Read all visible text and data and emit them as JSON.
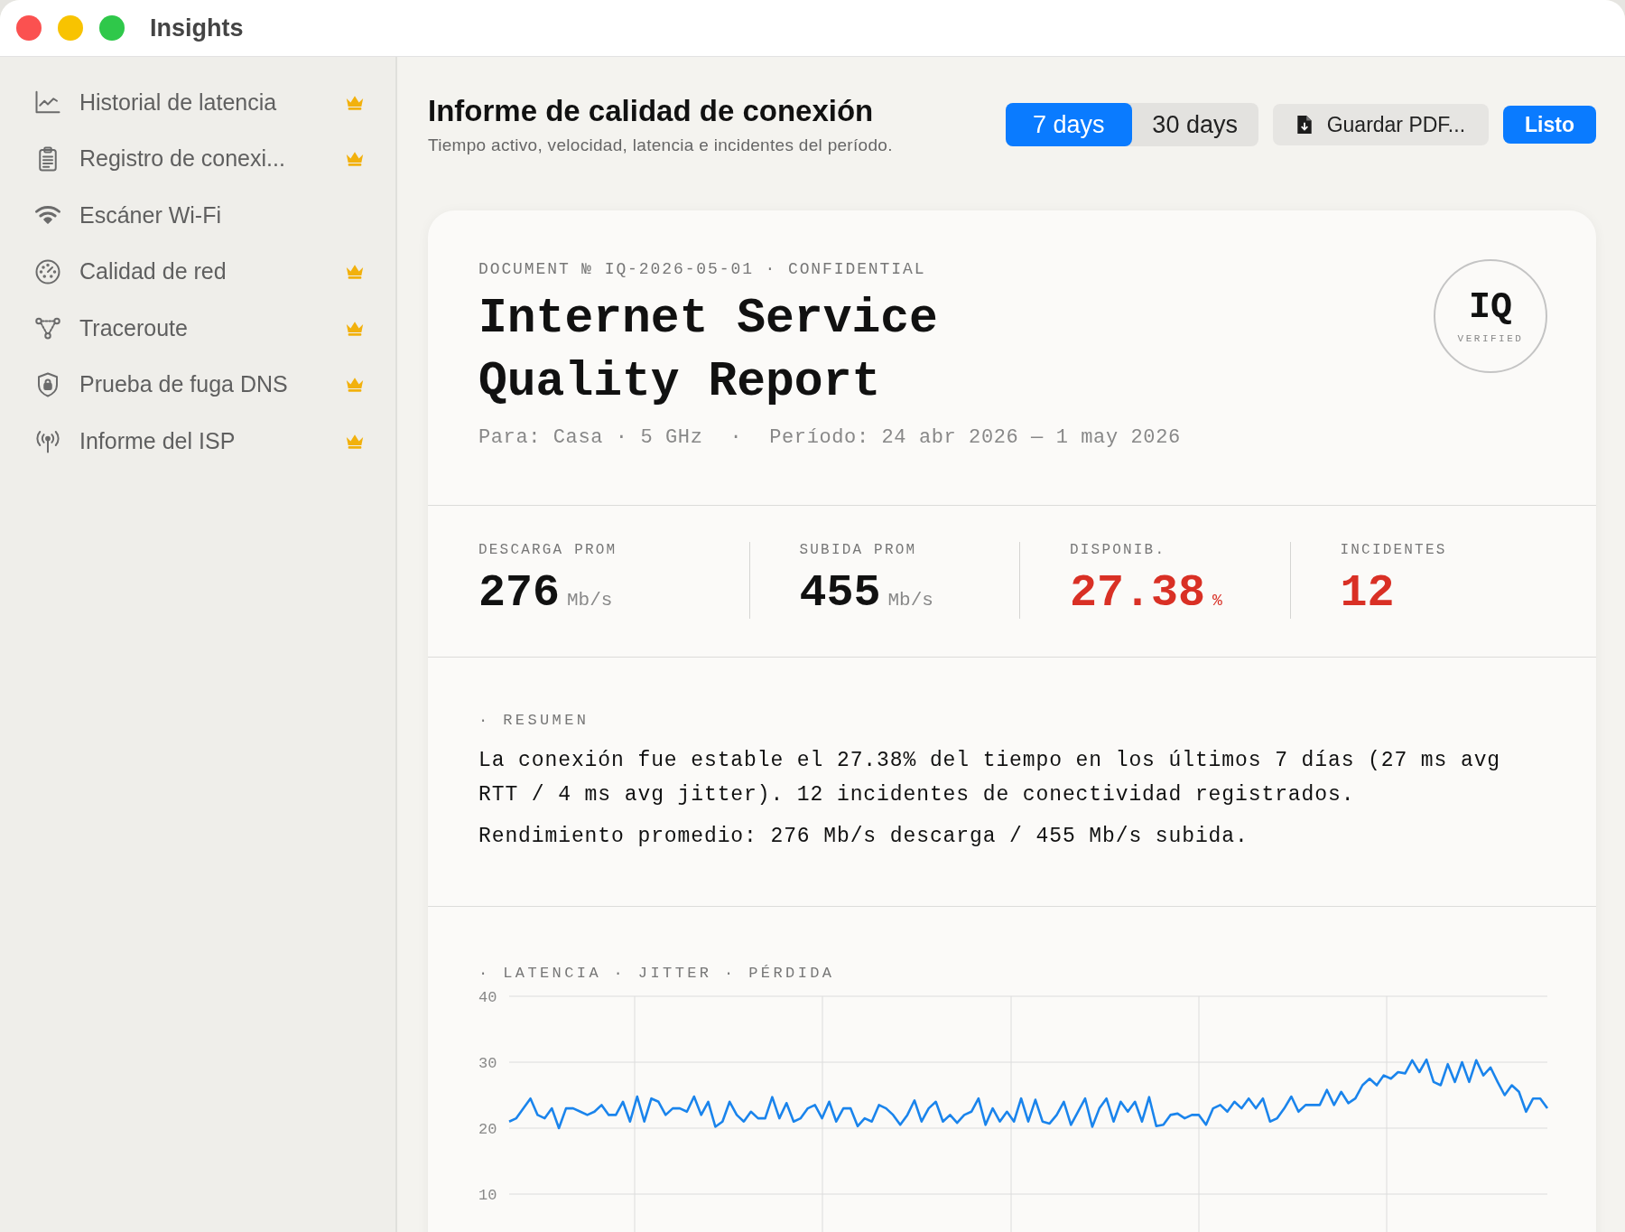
{
  "window": {
    "title": "Insights"
  },
  "sidebar": {
    "items": [
      {
        "label": "Historial de latencia",
        "premium": true
      },
      {
        "label": "Registro de conexi...",
        "premium": true
      },
      {
        "label": "Escáner Wi-Fi",
        "premium": false
      },
      {
        "label": "Calidad de red",
        "premium": true
      },
      {
        "label": "Traceroute",
        "premium": true
      },
      {
        "label": "Prueba de fuga DNS",
        "premium": true
      },
      {
        "label": "Informe del ISP",
        "premium": true
      }
    ]
  },
  "header": {
    "title": "Informe de calidad de conexión",
    "subtitle": "Tiempo activo, velocidad, latencia e incidentes del período.",
    "ranges": [
      {
        "label": "7 days",
        "selected": true
      },
      {
        "label": "30 days",
        "selected": false
      }
    ],
    "save_button": "Guardar PDF...",
    "done_button": "Listo"
  },
  "report": {
    "doc_number": "DOCUMENT № IQ-2026-05-01 · CONFIDENTIAL",
    "title": "Internet Service Quality Report",
    "meta": [
      "Para: Casa · 5 GHz",
      "Período: 24 abr 2026 — 1 may 2026"
    ],
    "meta_separator": "·",
    "stamp": {
      "mark": "IQ",
      "label": "VERIFIED"
    },
    "stats": [
      {
        "label": "DESCARGA PROM",
        "value": "276",
        "unit": "Mb/s",
        "alert": false
      },
      {
        "label": "SUBIDA PROM",
        "value": "455",
        "unit": "Mb/s",
        "alert": false
      },
      {
        "label": "DISPONIB.",
        "value": "27.38",
        "unit": "%",
        "alert": true
      },
      {
        "label": "INCIDENTES",
        "value": "12",
        "alert": true
      }
    ],
    "summary": {
      "label": "· RESUMEN",
      "paragraphs": [
        "La conexión fue estable el 27.38% del tiempo en los últimos 7 días (27 ms avg RTT / 4 ms avg jitter). 12 incidentes de conectividad registrados.",
        "Rendimiento promedio: 276 Mb/s descarga / 455 Mb/s subida."
      ]
    },
    "chart": {
      "chart_data": {
        "type": "line",
        "title": "· LATENCIA · JITTER · PÉRDIDA",
        "grid": true,
        "ylim": [
          10,
          40
        ],
        "yticks": [
          10,
          20,
          30,
          40
        ],
        "series": [
          {
            "color": "#1a84ec",
            "values": [
              21,
              21.5,
              23,
              24.5,
              22,
              21.5,
              23,
              20,
              23,
              23,
              22.5,
              22,
              22.5,
              23.5,
              22,
              22,
              24,
              21,
              24.8,
              21,
              24.5,
              24,
              22,
              23,
              23,
              22.5,
              24.8,
              22,
              24,
              20.2,
              21,
              24,
              22,
              21,
              22.5,
              21.5,
              21.5,
              24.7,
              21.5,
              23.8,
              21,
              21.5,
              23,
              23.5,
              21.5,
              24,
              21,
              23,
              23,
              20.3,
              21.5,
              21,
              23.5,
              23,
              22,
              20.5,
              22,
              24.2,
              21,
              23,
              24,
              21,
              22,
              20.8,
              22,
              22.5,
              24.5,
              20.5,
              23,
              21,
              22.5,
              21,
              24.5,
              21,
              24.3,
              21,
              20.7,
              22,
              24,
              20.5,
              22.5,
              24.5,
              20.2,
              23,
              24.5,
              21,
              24,
              22.5,
              24,
              21,
              24.7,
              20.3,
              20.5,
              22,
              22.2,
              21.5,
              22,
              22,
              20.5,
              23,
              23.5,
              22.5,
              24,
              23,
              24.5,
              23,
              24.5,
              21,
              21.5,
              23,
              24.8,
              22.5,
              23.5,
              23.5,
              23.5,
              25.8,
              23.5,
              25.5,
              23.8,
              24.5,
              26.5,
              27.5,
              26.5,
              28,
              27.5,
              28.5,
              28.3,
              30.3,
              28.5,
              30.4,
              27,
              26.5,
              29.7,
              27,
              30,
              27,
              30.3,
              28,
              29.2,
              27,
              25,
              26.5,
              25.5,
              22.5,
              24.5,
              24.5,
              23
            ]
          }
        ]
      }
    }
  }
}
